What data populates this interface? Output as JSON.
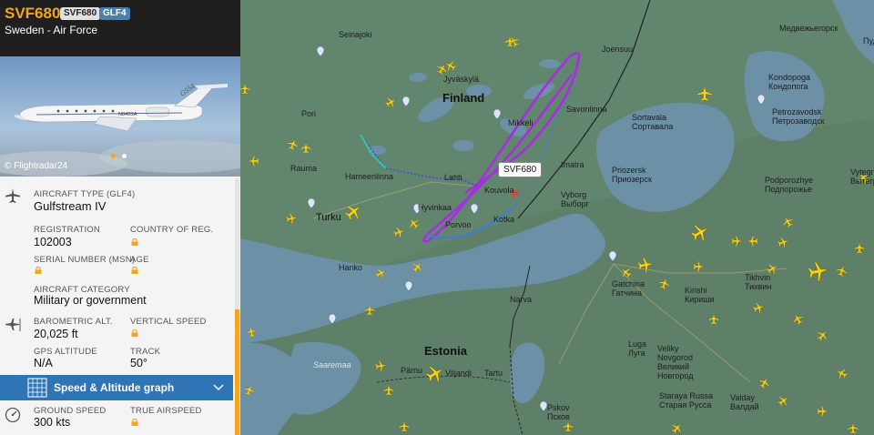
{
  "flight": {
    "callsign": "SVF680",
    "callsign_pill": "SVF680",
    "type_pill": "GLF4",
    "operator": "Sweden - Air Force"
  },
  "photo": {
    "credit": "© Flightradar24",
    "registration_painted": "N840SA",
    "tail_text": "G554"
  },
  "details": {
    "aircraft_type_label": "AIRCRAFT TYPE (GLF4)",
    "aircraft_type": "Gulfstream IV",
    "registration_label": "REGISTRATION",
    "registration": "102003",
    "country_label": "COUNTRY OF REG.",
    "serial_label": "SERIAL NUMBER (MSN)",
    "age_label": "AGE",
    "category_label": "AIRCRAFT CATEGORY",
    "category": "Military or government",
    "baro_alt_label": "BAROMETRIC ALT.",
    "baro_alt": "20,025 ft",
    "vs_label": "VERTICAL SPEED",
    "gps_alt_label": "GPS ALTITUDE",
    "gps_alt": "N/A",
    "track_label": "TRACK",
    "track": "50°",
    "speed_graph_label": "Speed & Altitude graph",
    "ground_speed_label": "GROUND SPEED",
    "ground_speed": "300 kts",
    "true_airspeed_label": "TRUE AIRSPEED"
  },
  "map": {
    "selected_tag": "SVF680",
    "countries": {
      "finland": "Finland",
      "estonia": "Estonia"
    },
    "cities": {
      "turku": "Turku",
      "hameenlinna": "Hameenlinna",
      "lahti": "Lahti",
      "kouvola": "Kouvola",
      "porvoo": "Porvoo",
      "kotka": "Kotka",
      "mikkeli": "Mikkeli",
      "savonlinna": "Savonlinna",
      "joensuu": "Joensuu",
      "jyvaskyla": "Jyväskylä",
      "seinajoki": "Seinajoki",
      "pori": "Pori",
      "rauma": "Rauma",
      "hanko": "Hanko",
      "narva": "Narva",
      "parnu": "Pärnu",
      "viljandi": "Viljandi",
      "tartu": "Tartu",
      "saaremaa": "Saaremaa",
      "imatra": "Imatra",
      "hyvinkaa": "Hyvinkaa",
      "vyborg": "Vyborg",
      "vyborg_ru": "Выборг",
      "priozersk": "Priozersk",
      "priozersk_ru": "Приозерск",
      "sortavala": "Sortavala",
      "sortavala_ru": "Сортавала",
      "kondopoga": "Kondopoga",
      "kondopoga_ru": "Кондопога",
      "petrozavodsk": "Petrozavodsk",
      "petrozavodsk_ru": "Петрозаводск",
      "podporozhye": "Podporozhye",
      "podporozhye_ru": "Подпорожье",
      "vytegra": "Vytegr",
      "vytegra_ru": "Вытегр",
      "gatchina": "Gatchina",
      "gatchina_ru": "Гатчина",
      "kirishi": "Kirishi",
      "kirishi_ru": "Кириши",
      "tikhvin": "Tikhvin",
      "tikhvin_ru": "Тихвин",
      "luga": "Luga",
      "luga_ru": "Луга",
      "veliky": "Veliky",
      "novgorod": "Novgorod",
      "veliky_ru": "Великий",
      "novgorod_ru": "Новгород",
      "staraya": "Staraya Russa",
      "staraya_ru": "Старая Русса",
      "valday": "Valday",
      "valday_ru": "Валдай",
      "pskov": "Pskov",
      "pskov_ru": "Псков",
      "medvezh": "Медвежьегорск",
      "pudo": "Пудо"
    }
  },
  "colors": {
    "accent": "#f2a51d",
    "header": "#1f1f1f",
    "speedbar": "#2f74b5",
    "pill_type": "#4a7fb0",
    "water": "#6b8fa6",
    "land": "#5b7d66",
    "track_purple": "#a52fe0",
    "track_blue": "#3d7ae0",
    "plane_yellow": "#f5d21d"
  }
}
